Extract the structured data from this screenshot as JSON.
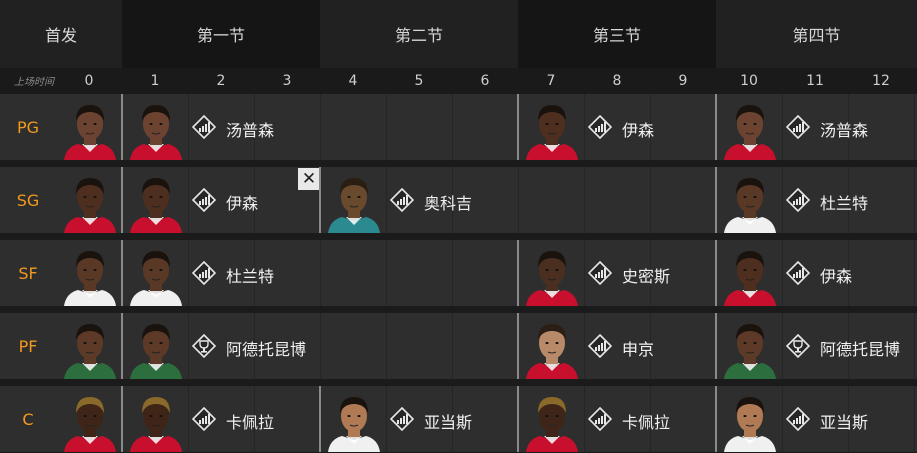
{
  "header": {
    "starters_label": "首发",
    "quarters": [
      "第一节",
      "第二节",
      "第三节",
      "第四节"
    ]
  },
  "timeline": {
    "label": "上场时间",
    "ticks": [
      "0",
      "1",
      "2",
      "3",
      "4",
      "5",
      "6",
      "7",
      "8",
      "9",
      "10",
      "11",
      "12"
    ]
  },
  "rows": [
    {
      "pos": "PG",
      "starter": {
        "skin": "#6b4330",
        "hair": "#1a120d",
        "jersey": "#c8102e"
      },
      "segments": [
        {
          "name": "汤普森",
          "badge": "bars",
          "skin": "#6b4330",
          "hair": "#1a120d",
          "jersey": "#c8102e"
        },
        {
          "name": "伊森",
          "badge": "bars",
          "skin": "#4e2f1f",
          "hair": "#1a120d",
          "jersey": "#c8102e"
        },
        {
          "name": "汤普森",
          "badge": "bars",
          "skin": "#6b4330",
          "hair": "#1a120d",
          "jersey": "#c8102e"
        }
      ]
    },
    {
      "pos": "SG",
      "starter": {
        "skin": "#4e2f1f",
        "hair": "#1a120d",
        "jersey": "#c8102e"
      },
      "segments": [
        {
          "name": "伊森",
          "badge": "bars",
          "skin": "#4e2f1f",
          "hair": "#1a120d",
          "jersey": "#c8102e"
        },
        {
          "name": "奥科吉",
          "badge": "bars",
          "skin": "#6a4a2c",
          "hair": "#2a1d12",
          "jersey": "#2a8a8f"
        },
        {
          "name": "杜兰特",
          "badge": "bars",
          "skin": "#5a3826",
          "hair": "#1a120d",
          "jersey": "#f0f0f0"
        }
      ]
    },
    {
      "pos": "SF",
      "starter": {
        "skin": "#5a3826",
        "hair": "#1a120d",
        "jersey": "#f0f0f0"
      },
      "segments": [
        {
          "name": "杜兰特",
          "badge": "bars",
          "skin": "#5a3826",
          "hair": "#1a120d",
          "jersey": "#f0f0f0"
        },
        {
          "name": "史密斯",
          "badge": "bars",
          "skin": "#4a2e20",
          "hair": "#1a120d",
          "jersey": "#c8102e"
        },
        {
          "name": "伊森",
          "badge": "bars",
          "skin": "#4e2f1f",
          "hair": "#1a120d",
          "jersey": "#c8102e"
        }
      ]
    },
    {
      "pos": "PF",
      "starter": {
        "skin": "#5c3a27",
        "hair": "#1a120d",
        "jersey": "#2d6e3e"
      },
      "segments": [
        {
          "name": "阿德托昆博",
          "badge": "trophy",
          "skin": "#5c3a27",
          "hair": "#1a120d",
          "jersey": "#2d6e3e"
        },
        {
          "name": "申京",
          "badge": "bars",
          "skin": "#b88a6a",
          "hair": "#2b1e14",
          "jersey": "#c8102e"
        },
        {
          "name": "阿德托昆博",
          "badge": "trophy",
          "skin": "#5c3a27",
          "hair": "#1a120d",
          "jersey": "#2d6e3e"
        }
      ]
    },
    {
      "pos": "C",
      "starter": {
        "skin": "#3f2518",
        "hair": "#8a6a2a",
        "jersey": "#c8102e"
      },
      "segments": [
        {
          "name": "卡佩拉",
          "badge": "bars",
          "skin": "#3f2518",
          "hair": "#8a6a2a",
          "jersey": "#c8102e"
        },
        {
          "name": "亚当斯",
          "badge": "bars",
          "skin": "#b07a55",
          "hair": "#1a120d",
          "jersey": "#f0f0f0"
        },
        {
          "name": "卡佩拉",
          "badge": "bars",
          "skin": "#3f2518",
          "hair": "#8a6a2a",
          "jersey": "#c8102e"
        },
        {
          "name": "亚当斯",
          "badge": "bars",
          "skin": "#b07a55",
          "hair": "#1a120d",
          "jersey": "#f0f0f0"
        }
      ]
    }
  ],
  "remove_button_glyph": "✕"
}
